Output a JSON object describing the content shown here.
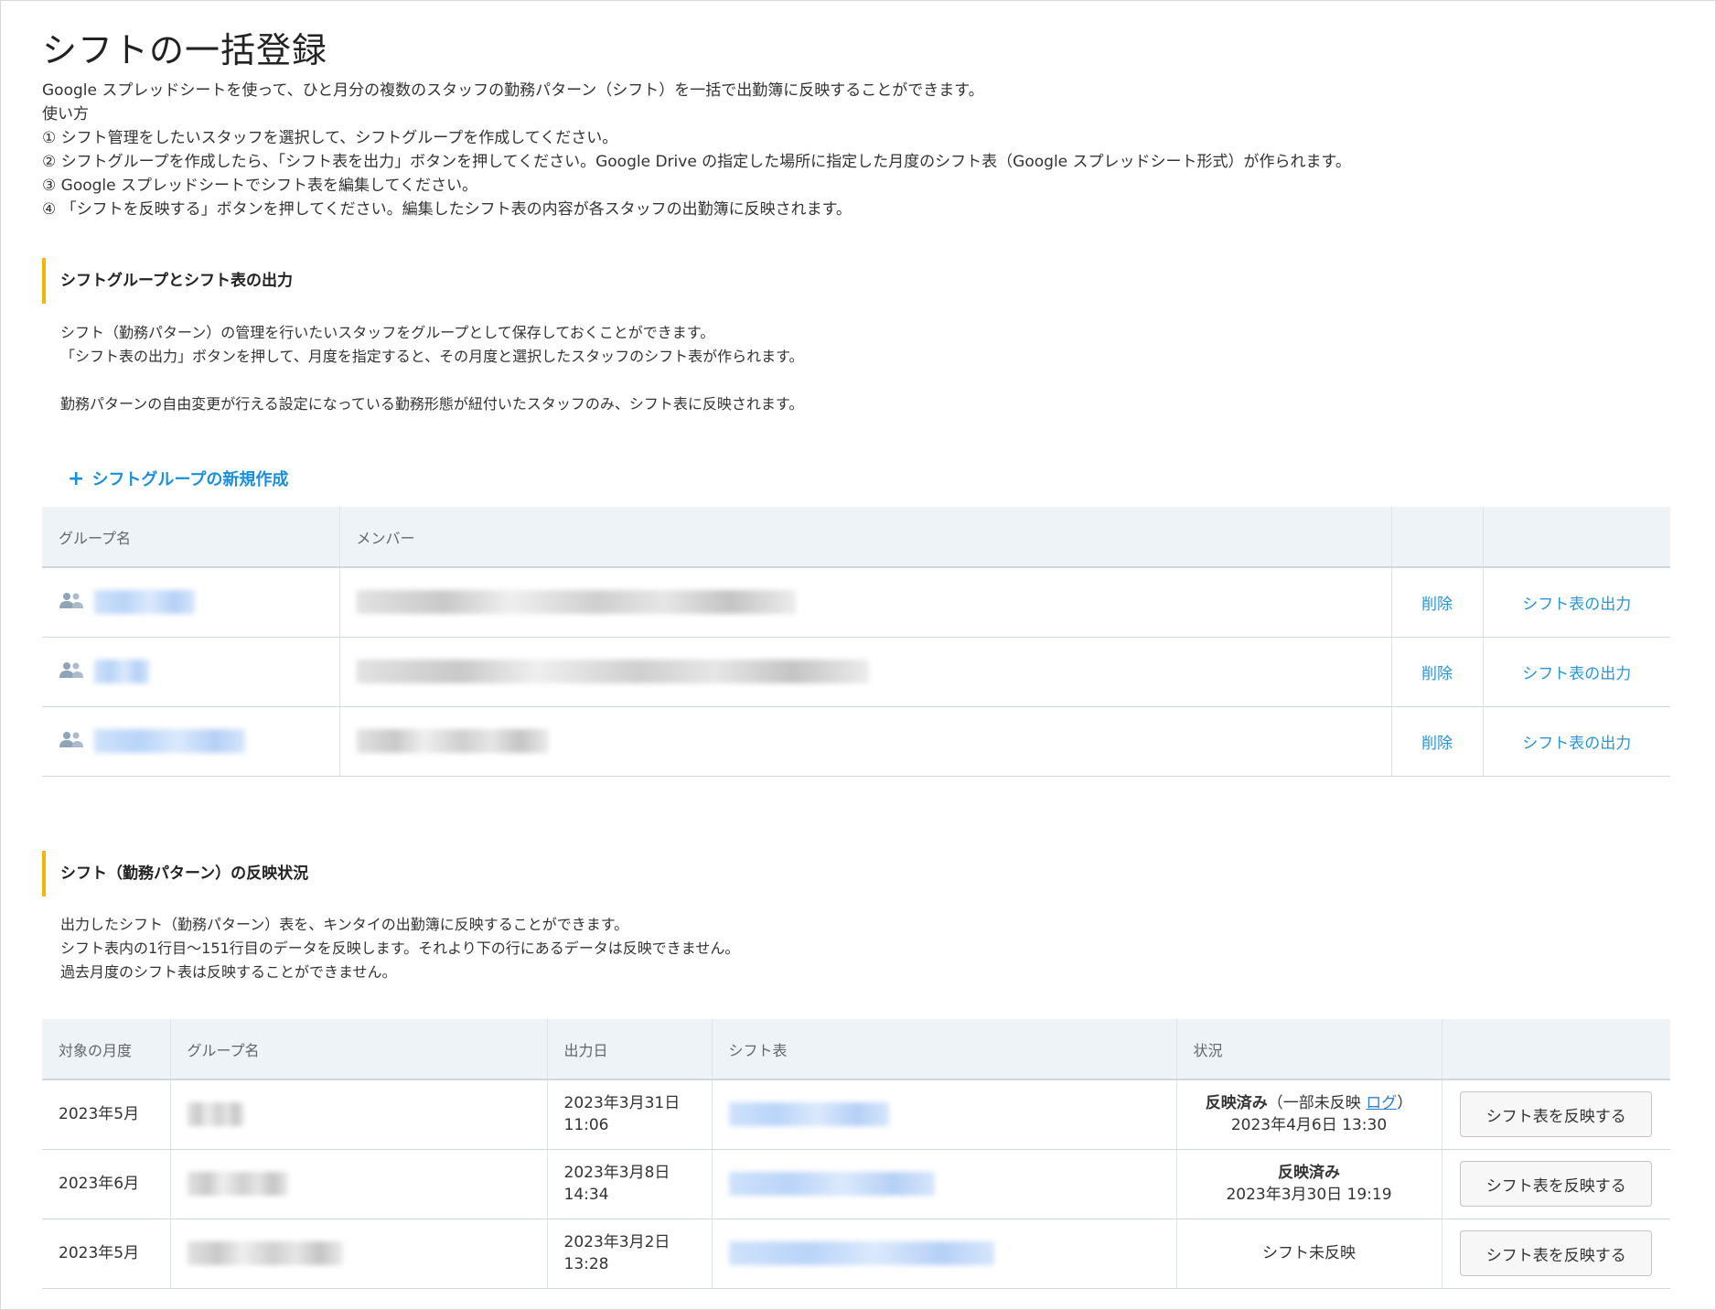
{
  "page": {
    "title": "シフトの一括登録",
    "intro": [
      "Google スプレッドシートを使って、ひと月分の複数のスタッフの勤務パターン（シフト）を一括で出勤簿に反映することができます。",
      "使い方",
      "① シフト管理をしたいスタッフを選択して、シフトグループを作成してください。",
      "② シフトグループを作成したら、「シフト表を出力」ボタンを押してください。Google Drive の指定した場所に指定した月度のシフト表（Google スプレッドシート形式）が作られます。",
      "③ Google スプレッドシートでシフト表を編集してください。",
      "④ 「シフトを反映する」ボタンを押してください。編集したシフト表の内容が各スタッフの出勤簿に反映されます。"
    ]
  },
  "groups_section": {
    "title": "シフトグループとシフト表の出力",
    "desc": [
      "シフト（勤務パターン）の管理を行いたいスタッフをグループとして保存しておくことができます。",
      "「シフト表の出力」ボタンを押して、月度を指定すると、その月度と選択したスタッフのシフト表が作られます。",
      "勤務パターンの自由変更が行える設定になっている勤務形態が紐付いたスタッフのみ、シフト表に反映されます。"
    ],
    "new_group_label": "シフトグループの新規作成",
    "columns": {
      "group": "グループ名",
      "member": "メンバー"
    },
    "rows": [
      {
        "delete_label": "削除",
        "export_label": "シフト表の出力"
      },
      {
        "delete_label": "削除",
        "export_label": "シフト表の出力"
      },
      {
        "delete_label": "削除",
        "export_label": "シフト表の出力"
      }
    ]
  },
  "status_section": {
    "title": "シフト（勤務パターン）の反映状況",
    "desc": [
      "出力したシフト（勤務パターン）表を、キンタイの出勤簿に反映することができます。",
      "シフト表内の1行目〜151行目のデータを反映します。それより下の行にあるデータは反映できません。",
      "過去月度のシフト表は反映することができません。"
    ],
    "columns": {
      "month": "対象の月度",
      "group": "グループ名",
      "date": "出力日",
      "sheet": "シフト表",
      "status": "状況"
    },
    "rows": [
      {
        "month": "2023年5月",
        "date_line1": "2023年3月31日",
        "date_line2": "11:06",
        "status_main": "反映済み",
        "status_sub_open": "（一部未反映 ",
        "status_log": "ログ",
        "status_sub_close": "）",
        "status_date": "2023年4月6日 13:30",
        "button": "シフト表を反映する"
      },
      {
        "month": "2023年6月",
        "date_line1": "2023年3月8日",
        "date_line2": "14:34",
        "status_main": "反映済み",
        "status_date": "2023年3月30日 19:19",
        "button": "シフト表を反映する"
      },
      {
        "month": "2023年5月",
        "date_line1": "2023年3月2日",
        "date_line2": "13:28",
        "status_plain": "シフト未反映",
        "button": "シフト表を反映する"
      }
    ]
  },
  "colors": {
    "accent_bar": "#f5b400",
    "link": "#2a95d6",
    "header_bg": "#eef3f8"
  },
  "icons": {
    "group": "people-group-icon",
    "plus": "plus-icon"
  }
}
